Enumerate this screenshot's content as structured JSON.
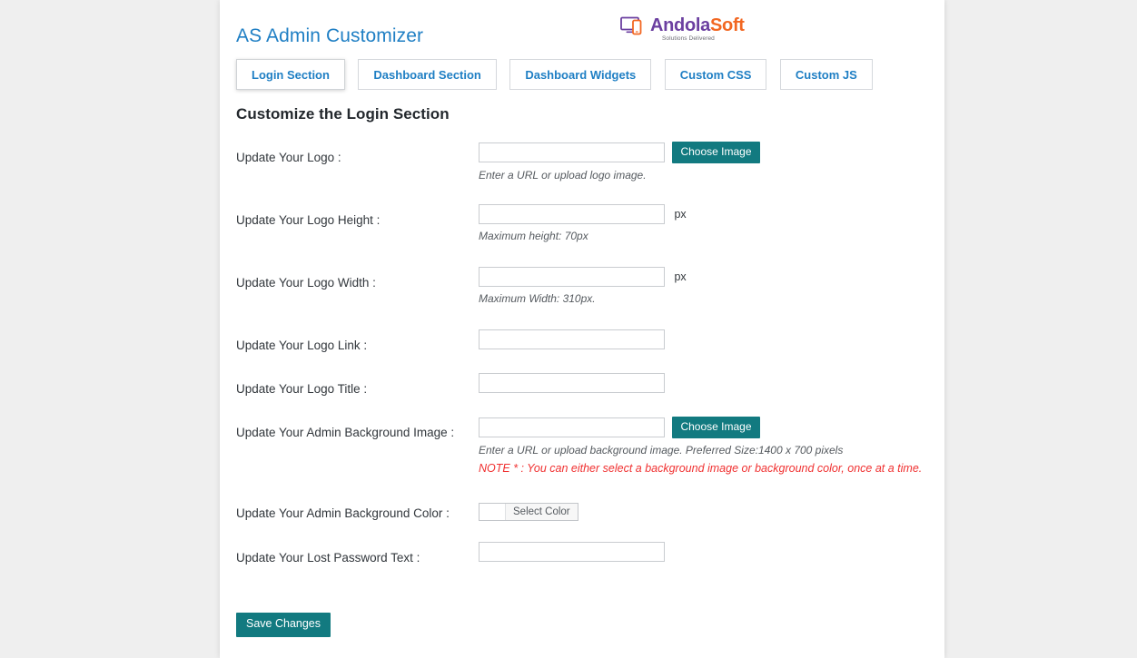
{
  "header": {
    "app_title": "AS Admin Customizer",
    "brand": {
      "name_part1": "Andola",
      "name_part2": "Soft",
      "tagline": "Solutions Delivered",
      "color_purple": "#6b3fa0",
      "color_orange": "#f26722"
    }
  },
  "tabs": [
    {
      "label": "Login Section",
      "active": true
    },
    {
      "label": "Dashboard Section",
      "active": false
    },
    {
      "label": "Dashboard Widgets",
      "active": false
    },
    {
      "label": "Custom CSS",
      "active": false
    },
    {
      "label": "Custom JS",
      "active": false
    }
  ],
  "main": {
    "section_title": "Customize the Login Section",
    "accent_teal": "#127a80",
    "accent_blue": "#1f7fc4",
    "note_red": "#f03030",
    "fields": [
      {
        "label": "Update Your Logo :",
        "value": "",
        "placeholder": "",
        "button": "Choose Image",
        "hint": "Enter a URL or upload logo image."
      },
      {
        "label": "Update Your Logo Height :",
        "value": "",
        "placeholder": "",
        "unit": "px",
        "hint": "Maximum height: 70px"
      },
      {
        "label": "Update Your Logo Width :",
        "value": "",
        "placeholder": "",
        "unit": "px",
        "hint": "Maximum Width: 310px."
      },
      {
        "label": "Update Your Logo Link :",
        "value": "",
        "placeholder": ""
      },
      {
        "label": "Update Your Logo Title :",
        "value": "",
        "placeholder": ""
      },
      {
        "label": "Update Your Admin Background Image :",
        "value": "",
        "placeholder": "",
        "button": "Choose Image",
        "hint": "Enter a URL or upload background image. Preferred Size:1400 x 700 pixels",
        "note": "NOTE * : You can either select a background image or background color, once at a time."
      },
      {
        "label": "Update Your Admin Background Color :",
        "color_button": "Select Color",
        "swatch_color": "#ffffff"
      },
      {
        "label": "Update Your Lost Password Text :",
        "value": "",
        "placeholder": ""
      }
    ],
    "save_label": "Save Changes"
  }
}
